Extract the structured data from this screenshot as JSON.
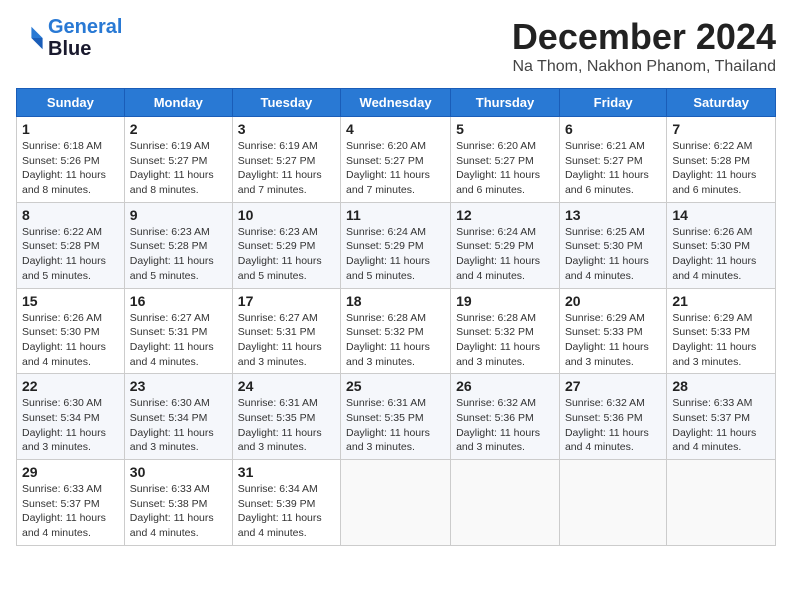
{
  "logo": {
    "line1": "General",
    "line2": "Blue"
  },
  "title": "December 2024",
  "location": "Na Thom, Nakhon Phanom, Thailand",
  "weekdays": [
    "Sunday",
    "Monday",
    "Tuesday",
    "Wednesday",
    "Thursday",
    "Friday",
    "Saturday"
  ],
  "weeks": [
    [
      {
        "day": "1",
        "info": "Sunrise: 6:18 AM\nSunset: 5:26 PM\nDaylight: 11 hours\nand 8 minutes."
      },
      {
        "day": "2",
        "info": "Sunrise: 6:19 AM\nSunset: 5:27 PM\nDaylight: 11 hours\nand 8 minutes."
      },
      {
        "day": "3",
        "info": "Sunrise: 6:19 AM\nSunset: 5:27 PM\nDaylight: 11 hours\nand 7 minutes."
      },
      {
        "day": "4",
        "info": "Sunrise: 6:20 AM\nSunset: 5:27 PM\nDaylight: 11 hours\nand 7 minutes."
      },
      {
        "day": "5",
        "info": "Sunrise: 6:20 AM\nSunset: 5:27 PM\nDaylight: 11 hours\nand 6 minutes."
      },
      {
        "day": "6",
        "info": "Sunrise: 6:21 AM\nSunset: 5:27 PM\nDaylight: 11 hours\nand 6 minutes."
      },
      {
        "day": "7",
        "info": "Sunrise: 6:22 AM\nSunset: 5:28 PM\nDaylight: 11 hours\nand 6 minutes."
      }
    ],
    [
      {
        "day": "8",
        "info": "Sunrise: 6:22 AM\nSunset: 5:28 PM\nDaylight: 11 hours\nand 5 minutes."
      },
      {
        "day": "9",
        "info": "Sunrise: 6:23 AM\nSunset: 5:28 PM\nDaylight: 11 hours\nand 5 minutes."
      },
      {
        "day": "10",
        "info": "Sunrise: 6:23 AM\nSunset: 5:29 PM\nDaylight: 11 hours\nand 5 minutes."
      },
      {
        "day": "11",
        "info": "Sunrise: 6:24 AM\nSunset: 5:29 PM\nDaylight: 11 hours\nand 5 minutes."
      },
      {
        "day": "12",
        "info": "Sunrise: 6:24 AM\nSunset: 5:29 PM\nDaylight: 11 hours\nand 4 minutes."
      },
      {
        "day": "13",
        "info": "Sunrise: 6:25 AM\nSunset: 5:30 PM\nDaylight: 11 hours\nand 4 minutes."
      },
      {
        "day": "14",
        "info": "Sunrise: 6:26 AM\nSunset: 5:30 PM\nDaylight: 11 hours\nand 4 minutes."
      }
    ],
    [
      {
        "day": "15",
        "info": "Sunrise: 6:26 AM\nSunset: 5:30 PM\nDaylight: 11 hours\nand 4 minutes."
      },
      {
        "day": "16",
        "info": "Sunrise: 6:27 AM\nSunset: 5:31 PM\nDaylight: 11 hours\nand 4 minutes."
      },
      {
        "day": "17",
        "info": "Sunrise: 6:27 AM\nSunset: 5:31 PM\nDaylight: 11 hours\nand 3 minutes."
      },
      {
        "day": "18",
        "info": "Sunrise: 6:28 AM\nSunset: 5:32 PM\nDaylight: 11 hours\nand 3 minutes."
      },
      {
        "day": "19",
        "info": "Sunrise: 6:28 AM\nSunset: 5:32 PM\nDaylight: 11 hours\nand 3 minutes."
      },
      {
        "day": "20",
        "info": "Sunrise: 6:29 AM\nSunset: 5:33 PM\nDaylight: 11 hours\nand 3 minutes."
      },
      {
        "day": "21",
        "info": "Sunrise: 6:29 AM\nSunset: 5:33 PM\nDaylight: 11 hours\nand 3 minutes."
      }
    ],
    [
      {
        "day": "22",
        "info": "Sunrise: 6:30 AM\nSunset: 5:34 PM\nDaylight: 11 hours\nand 3 minutes."
      },
      {
        "day": "23",
        "info": "Sunrise: 6:30 AM\nSunset: 5:34 PM\nDaylight: 11 hours\nand 3 minutes."
      },
      {
        "day": "24",
        "info": "Sunrise: 6:31 AM\nSunset: 5:35 PM\nDaylight: 11 hours\nand 3 minutes."
      },
      {
        "day": "25",
        "info": "Sunrise: 6:31 AM\nSunset: 5:35 PM\nDaylight: 11 hours\nand 3 minutes."
      },
      {
        "day": "26",
        "info": "Sunrise: 6:32 AM\nSunset: 5:36 PM\nDaylight: 11 hours\nand 3 minutes."
      },
      {
        "day": "27",
        "info": "Sunrise: 6:32 AM\nSunset: 5:36 PM\nDaylight: 11 hours\nand 4 minutes."
      },
      {
        "day": "28",
        "info": "Sunrise: 6:33 AM\nSunset: 5:37 PM\nDaylight: 11 hours\nand 4 minutes."
      }
    ],
    [
      {
        "day": "29",
        "info": "Sunrise: 6:33 AM\nSunset: 5:37 PM\nDaylight: 11 hours\nand 4 minutes."
      },
      {
        "day": "30",
        "info": "Sunrise: 6:33 AM\nSunset: 5:38 PM\nDaylight: 11 hours\nand 4 minutes."
      },
      {
        "day": "31",
        "info": "Sunrise: 6:34 AM\nSunset: 5:39 PM\nDaylight: 11 hours\nand 4 minutes."
      },
      {
        "day": "",
        "info": ""
      },
      {
        "day": "",
        "info": ""
      },
      {
        "day": "",
        "info": ""
      },
      {
        "day": "",
        "info": ""
      }
    ]
  ]
}
